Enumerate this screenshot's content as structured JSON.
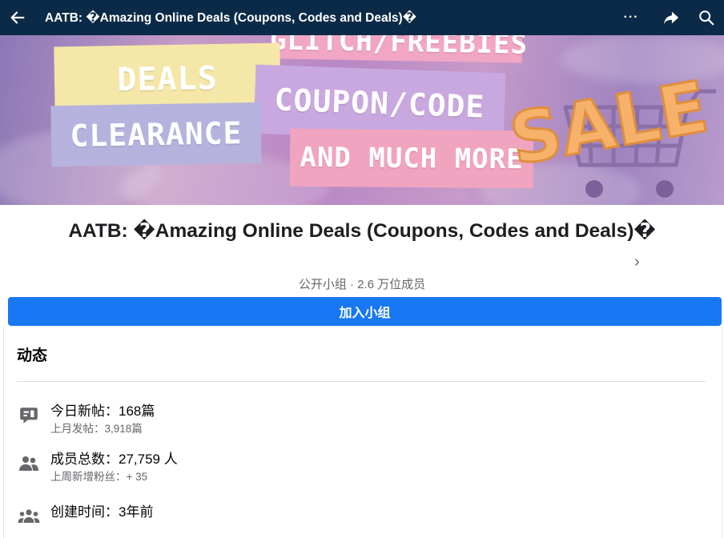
{
  "header": {
    "title": "AATB: �Amazing Online Deals (Coupons, Codes and Deals)�",
    "more_label": "···"
  },
  "cover": {
    "texts": {
      "glitch": "GLITCH/FREEBIES",
      "deals": "DEALS",
      "coupon": "COUPON/CODE",
      "clearance": "CLEARANCE",
      "more": "AND MUCH MORE",
      "sale": "SALE"
    }
  },
  "group": {
    "name": "AATB: �Amazing Online Deals (Coupons, Codes and Deals)�",
    "meta": "公开小组 · 2.6 万位成员"
  },
  "join_button": {
    "label": "加入小组"
  },
  "activity": {
    "title": "动态",
    "stats": [
      {
        "icon": "chat-bubble-icon",
        "main": "今日新帖：168篇",
        "sub": "上月发帖：3,918篇"
      },
      {
        "icon": "people-icon",
        "main": "成员总数：27,759 人",
        "sub": "上周新增粉丝：+ 35"
      },
      {
        "icon": "group-icon",
        "main": "创建时间：3年前",
        "sub": ""
      }
    ]
  },
  "colors": {
    "topbar": "#0b2a47",
    "join": "#1877f2",
    "secondary_text": "#65676b"
  }
}
